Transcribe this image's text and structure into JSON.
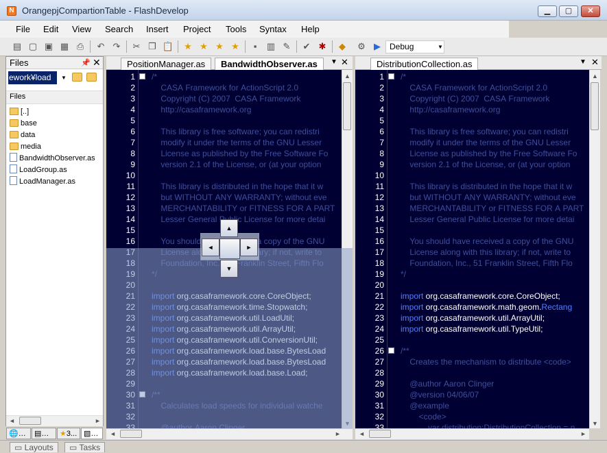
{
  "window": {
    "title": "OrangepjCompartionTable - FlashDevelop",
    "minimize": "▁",
    "maximize": "▢",
    "close": "✕"
  },
  "menu": [
    "File",
    "Edit",
    "View",
    "Search",
    "Insert",
    "Project",
    "Tools",
    "Syntax",
    "Help"
  ],
  "toolbar": {
    "configuration": "Debug"
  },
  "files_panel": {
    "title": "Files",
    "path_value": "ework¥load",
    "section_label": "Files",
    "items": [
      {
        "name": "[..]",
        "type": "up"
      },
      {
        "name": "base",
        "type": "folder"
      },
      {
        "name": "data",
        "type": "folder"
      },
      {
        "name": "media",
        "type": "folder"
      },
      {
        "name": "BandwidthObserver.as",
        "type": "file"
      },
      {
        "name": "LoadGroup.as",
        "type": "file"
      },
      {
        "name": "LoadManager.as",
        "type": "file"
      }
    ],
    "bottom_tabs": [
      "3..."
    ]
  },
  "bottom_panels": [
    "Layouts",
    "Tasks"
  ],
  "editor_left": {
    "tabs": [
      "PositionManager.as",
      "BandwidthObserver.as"
    ],
    "active_tab": 1,
    "lines": [
      {
        "n": "1",
        "t": "/*",
        "c": "cm"
      },
      {
        "n": "2",
        "t": "    CASA Framework for ActionScript 2.0",
        "c": "cm"
      },
      {
        "n": "3",
        "t": "    Copyright (C) 2007  CASA Framework",
        "c": "cm"
      },
      {
        "n": "4",
        "t": "    http://casaframework.org",
        "c": "cm"
      },
      {
        "n": "5",
        "t": "",
        "c": "cm"
      },
      {
        "n": "6",
        "t": "    This library is free software; you can redistri",
        "c": "cm"
      },
      {
        "n": "7",
        "t": "    modify it under the terms of the GNU Lesser",
        "c": "cm"
      },
      {
        "n": "8",
        "t": "    License as published by the Free Software Fo",
        "c": "cm"
      },
      {
        "n": "9",
        "t": "    version 2.1 of the License, or (at your option",
        "c": "cm"
      },
      {
        "n": "10",
        "t": "",
        "c": "cm"
      },
      {
        "n": "11",
        "t": "    This library is distributed in the hope that it w",
        "c": "cm"
      },
      {
        "n": "12",
        "t": "    but WITHOUT ANY WARRANTY; without eve",
        "c": "cm"
      },
      {
        "n": "13",
        "t": "    MERCHANTABILITY or FITNESS FOR A PART",
        "c": "cm"
      },
      {
        "n": "14",
        "t": "    Lesser General Public License for more detai",
        "c": "cm"
      },
      {
        "n": "15",
        "t": "",
        "c": "cm"
      },
      {
        "n": "16",
        "t": "    You should have received a copy of the GNU",
        "c": "cm"
      },
      {
        "n": "17",
        "t": "    License along with this library; if not, write to",
        "c": "cm"
      },
      {
        "n": "18",
        "t": "    Foundation, Inc., 51 Franklin Street, Fifth Flo",
        "c": "cm"
      },
      {
        "n": "19",
        "t": "*/",
        "c": "cm"
      },
      {
        "n": "20",
        "t": "",
        "c": "code"
      },
      {
        "n": "21",
        "kw": "import",
        "t": " org.casaframework.core.CoreObject;",
        "c": "code"
      },
      {
        "n": "22",
        "kw": "import",
        "t": " org.casaframework.time.Stopwatch;",
        "c": "code"
      },
      {
        "n": "23",
        "kw": "import",
        "t": " org.casaframework.util.LoadUtil;",
        "c": "code"
      },
      {
        "n": "24",
        "kw": "import",
        "t": " org.casaframework.util.ArrayUtil;",
        "c": "code"
      },
      {
        "n": "25",
        "kw": "import",
        "t": " org.casaframework.util.ConversionUtil;",
        "c": "code"
      },
      {
        "n": "26",
        "kw": "import",
        "t": " org.casaframework.load.base.BytesLoad",
        "c": "code"
      },
      {
        "n": "27",
        "kw": "import",
        "t": " org.casaframework.load.base.BytesLoad",
        "c": "code"
      },
      {
        "n": "28",
        "kw": "import",
        "t": " org.casaframework.load.base.Load;",
        "c": "code"
      },
      {
        "n": "29",
        "t": "",
        "c": "code"
      },
      {
        "n": "30",
        "t": "/**",
        "c": "cm"
      },
      {
        "n": "31",
        "t": "    Calculates load speeds for individual watche",
        "c": "cm"
      },
      {
        "n": "32",
        "t": "",
        "c": "cm"
      },
      {
        "n": "33",
        "t": "    @author Aaron Clinger",
        "c": "cm"
      }
    ]
  },
  "editor_right": {
    "tabs": [
      "DistributionCollection.as"
    ],
    "active_tab": 0,
    "lines": [
      {
        "n": "1",
        "t": "/*",
        "c": "cm"
      },
      {
        "n": "2",
        "t": "    CASA Framework for ActionScript 2.0",
        "c": "cm"
      },
      {
        "n": "3",
        "t": "    Copyright (C) 2007  CASA Framework",
        "c": "cm"
      },
      {
        "n": "4",
        "t": "    http://casaframework.org",
        "c": "cm"
      },
      {
        "n": "5",
        "t": "",
        "c": "cm"
      },
      {
        "n": "6",
        "t": "    This library is free software; you can redistri",
        "c": "cm"
      },
      {
        "n": "7",
        "t": "    modify it under the terms of the GNU Lesser",
        "c": "cm"
      },
      {
        "n": "8",
        "t": "    License as published by the Free Software Fo",
        "c": "cm"
      },
      {
        "n": "9",
        "t": "    version 2.1 of the License, or (at your option",
        "c": "cm"
      },
      {
        "n": "10",
        "t": "",
        "c": "cm"
      },
      {
        "n": "11",
        "t": "    This library is distributed in the hope that it w",
        "c": "cm"
      },
      {
        "n": "12",
        "t": "    but WITHOUT ANY WARRANTY; without eve",
        "c": "cm"
      },
      {
        "n": "13",
        "t": "    MERCHANTABILITY or FITNESS FOR A PART",
        "c": "cm"
      },
      {
        "n": "14",
        "t": "    Lesser General Public License for more detai",
        "c": "cm"
      },
      {
        "n": "15",
        "t": "",
        "c": "cm"
      },
      {
        "n": "16",
        "t": "    You should have received a copy of the GNU",
        "c": "cm"
      },
      {
        "n": "17",
        "t": "    License along with this library; if not, write to",
        "c": "cm"
      },
      {
        "n": "18",
        "t": "    Foundation, Inc., 51 Franklin Street, Fifth Flo",
        "c": "cm"
      },
      {
        "n": "19",
        "t": "*/",
        "c": "cm"
      },
      {
        "n": "20",
        "t": "",
        "c": "code"
      },
      {
        "n": "21",
        "kw": "import",
        "t": " org.casaframework.core.CoreObject;",
        "c": "code"
      },
      {
        "n": "22",
        "kw": "import",
        "t": " org.casaframework.math.geom.",
        "cls": "Rectang",
        "c": "code"
      },
      {
        "n": "23",
        "kw": "import",
        "t": " org.casaframework.util.ArrayUtil;",
        "c": "code"
      },
      {
        "n": "24",
        "kw": "import",
        "t": " org.casaframework.util.TypeUtil;",
        "c": "code"
      },
      {
        "n": "25",
        "t": "",
        "c": "code"
      },
      {
        "n": "26",
        "t": "/**",
        "c": "cm"
      },
      {
        "n": "27",
        "t": "    Creates the mechanism to distribute <code>",
        "c": "cm"
      },
      {
        "n": "28",
        "t": "",
        "c": "cm"
      },
      {
        "n": "29",
        "t": "    @author Aaron Clinger",
        "c": "cm"
      },
      {
        "n": "30",
        "t": "    @version 04/06/07",
        "c": "cm"
      },
      {
        "n": "31",
        "t": "    @example",
        "c": "cm"
      },
      {
        "n": "32",
        "t": "        <code>",
        "c": "cm"
      },
      {
        "n": "33",
        "t": "            var distribution:DistributionCollection = n",
        "c": "cm"
      }
    ]
  }
}
